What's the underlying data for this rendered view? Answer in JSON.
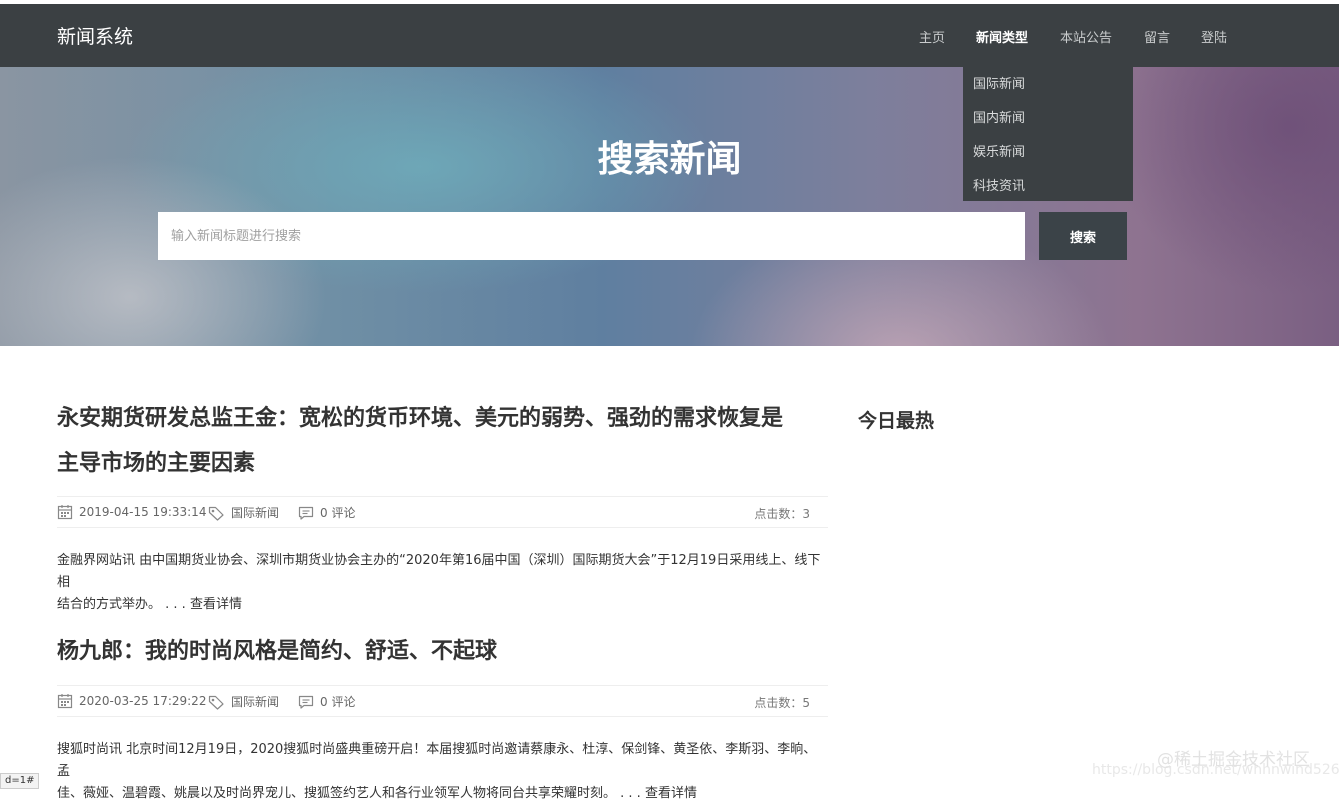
{
  "navbar": {
    "brand": "新闻系统",
    "items": [
      {
        "label": "主页"
      },
      {
        "label": "新闻类型"
      },
      {
        "label": "本站公告"
      },
      {
        "label": "留言"
      },
      {
        "label": "登陆"
      }
    ],
    "dropdown": [
      "国际新闻",
      "国内新闻",
      "娱乐新闻",
      "科技资讯"
    ]
  },
  "hero": {
    "title": "搜索新闻",
    "search_placeholder": "输入新闻标题进行搜索",
    "search_button": "搜索"
  },
  "articles": [
    {
      "title_line1": "永安期货研发总监王金：宽松的货币环境、美元的弱势、强劲的需求恢复是",
      "title_line2": "主导市场的主要因素",
      "date": "2019-04-15 19:33:14",
      "category": "国际新闻",
      "comments": "0 评论",
      "clicks": "点击数：3",
      "summary_line1": "金融界网站讯 由中国期货业协会、深圳市期货业协会主办的“2020年第16届中国（深圳）国际期货大会”于12月19日采用线上、线下相",
      "summary_line2": "结合的方式举办。 . . . ",
      "more": "查看详情"
    },
    {
      "title_line1": "杨九郎：我的时尚风格是简约、舒适、不起球",
      "date": "2020-03-25 17:29:22",
      "category": "国际新闻",
      "comments": "0 评论",
      "clicks": "点击数：5",
      "summary_line1": "搜狐时尚讯 北京时间12月19日，2020搜狐时尚盛典重磅开启！本届搜狐时尚邀请蔡康永、杜淳、保剑锋、黄圣依、李斯羽、李晌、孟",
      "summary_line2": "佳、薇娅、温碧霞、姚晨以及时尚界宠儿、搜狐签约艺人和各行业领军人物将同台共享荣耀时刻。 . . . ",
      "more": "查看详情"
    }
  ],
  "sidebar": {
    "title": "今日最热"
  },
  "watermark": {
    "line1": "@稀土掘金技术社区",
    "line2": "https://blog.csdn.net/whhnwind526"
  },
  "corner_tag": "d=1#"
}
